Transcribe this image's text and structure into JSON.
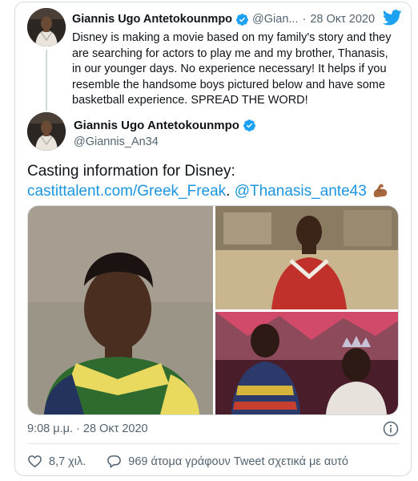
{
  "reply_context": {
    "author_name": "Giannis Ugo Antetokounmpo",
    "handle": "@Gian...",
    "separator": "·",
    "date": "28 Οκτ 2020",
    "text": "Disney is making a movie based on my family's story and they are searching for actors to play me and my brother, Thanasis, in our younger days. No experience necessary! It helps if you resemble the handsome boys pictured below and have some basketball experience. SPREAD THE WORD!"
  },
  "tweet": {
    "author_name": "Giannis Ugo Antetokounmpo",
    "handle": "@Giannis_An34",
    "text_line1": "Casting information for Disney:",
    "link_url": "castittalent.com/Greek_Freak",
    "link_sep": ". ",
    "mention": "@Thanasis_ante43",
    "emoji_icon": "flexed-biceps-icon",
    "timestamp": "9:08 μ.μ. · 28 Οκτ 2020",
    "likes": "8,7 χιλ.",
    "replies_text": "969 άτομα γράφουν Tweet σχετικά με αυτό"
  },
  "icons": {
    "verified": "verified-badge-icon",
    "brand": "twitter-bird-icon",
    "info": "info-icon",
    "like": "heart-icon",
    "reply": "speech-bubble-icon"
  },
  "colors": {
    "brand_blue": "#1da1f2",
    "link_blue": "#1b95e0",
    "muted": "#536471",
    "text": "#0f1419"
  }
}
